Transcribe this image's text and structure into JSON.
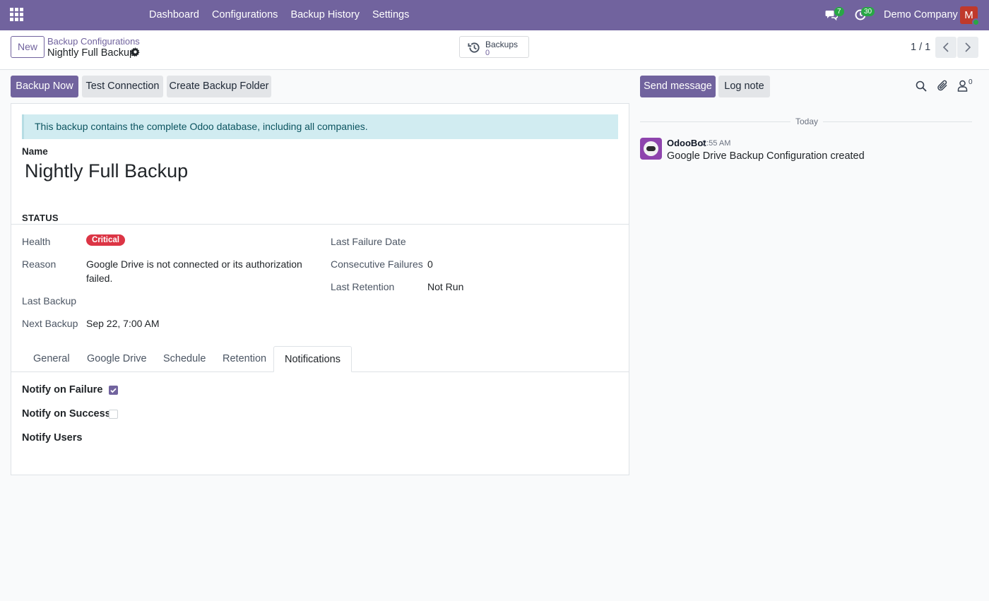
{
  "navbar": {
    "menu": [
      "Dashboard",
      "Configurations",
      "Backup History",
      "Settings"
    ],
    "messages_count": "7",
    "activities_count": "30",
    "company": "Demo Company",
    "avatar_initial": "M"
  },
  "control_panel": {
    "new_label": "New",
    "breadcrumb_parent": "Backup Configurations",
    "breadcrumb_current": "Nightly Full Backup",
    "smart_button": {
      "label": "Backups",
      "value": "0"
    },
    "pager": "1 / 1"
  },
  "actions": {
    "backup_now": "Backup Now",
    "test_connection": "Test Connection",
    "create_folder": "Create Backup Folder"
  },
  "form": {
    "alert": "This backup contains the complete Odoo database, including all companies.",
    "name_label": "Name",
    "name_value": "Nightly Full Backup",
    "status_title": "STATUS",
    "health_label": "Health",
    "health_value": "Critical",
    "reason_label": "Reason",
    "reason_line1": "Google Drive is not connected or its authorization",
    "reason_line2": "failed.",
    "last_backup_label": "Last Backup",
    "last_backup_value": "",
    "next_backup_label": "Next Backup",
    "next_backup_value": "Sep 22, 7:00 AM",
    "last_failure_label": "Last Failure Date",
    "last_failure_value": "",
    "consecutive_label": "Consecutive Failures",
    "consecutive_value": "0",
    "retention_label": "Last Retention",
    "retention_value": "Not Run",
    "tabs": [
      "General",
      "Google Drive",
      "Schedule",
      "Retention",
      "Notifications"
    ],
    "active_tab": "Notifications",
    "notify_failure_label": "Notify on Failure",
    "notify_failure": true,
    "notify_success_label": "Notify on Success",
    "notify_success": false,
    "notify_users_label": "Notify Users"
  },
  "chatter": {
    "send_message": "Send message",
    "log_note": "Log note",
    "followers_count": "0",
    "date_separator": "Today",
    "message": {
      "author": "OdooBot",
      "time": "2:55 AM",
      "body": "Google Drive Backup Configuration created"
    }
  },
  "colors": {
    "brand": "#71639e",
    "danger": "#dc3545",
    "success": "#28a745",
    "info_bg": "#d1ecf1"
  }
}
